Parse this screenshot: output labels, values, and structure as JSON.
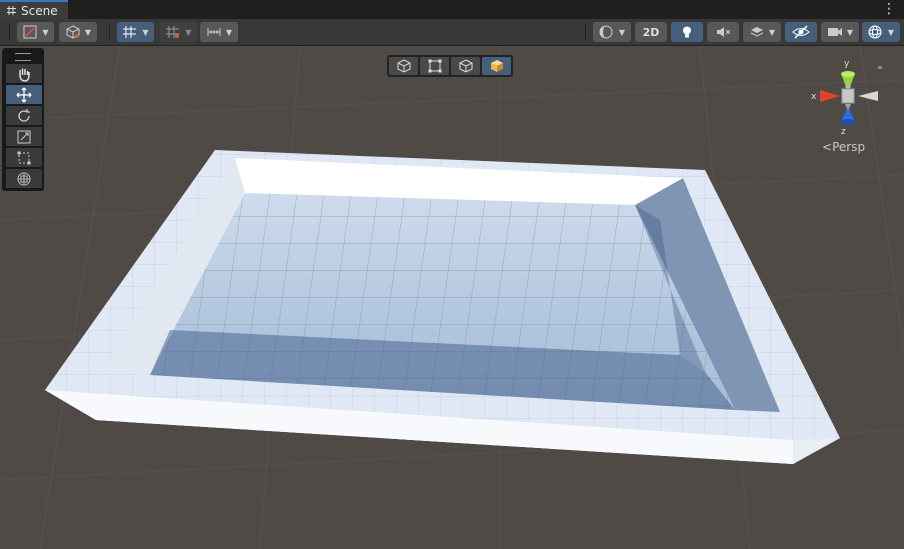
{
  "window": {
    "tab_title": "Scene",
    "menu_icon": "kebab-menu-icon"
  },
  "toolbar": {
    "left_buttons": [
      {
        "name": "draw-mode-button",
        "icon": "draw-mode-icon",
        "has_dropdown": true
      },
      {
        "name": "render-mode-button",
        "icon": "cube-icon",
        "has_dropdown": true
      },
      {
        "name": "grid-snap-button",
        "icon": "grid-snap-icon",
        "has_dropdown": true,
        "active": true
      },
      {
        "name": "grid-settings-button",
        "icon": "grid-icon",
        "has_dropdown": true
      },
      {
        "name": "increment-snap-button",
        "icon": "ruler-icon",
        "has_dropdown": true
      }
    ],
    "right_buttons": [
      {
        "name": "shading-mode-button",
        "icon": "sphere-icon",
        "has_dropdown": true
      },
      {
        "name": "2d-toggle",
        "label": "2D"
      },
      {
        "name": "lighting-toggle",
        "icon": "bulb-icon",
        "active": true
      },
      {
        "name": "audio-toggle",
        "icon": "mute-icon"
      },
      {
        "name": "effects-button",
        "icon": "layers-icon",
        "has_dropdown": true
      },
      {
        "name": "visibility-toggle",
        "icon": "eye-hidden-icon",
        "active": true
      },
      {
        "name": "camera-button",
        "icon": "camera-icon",
        "has_dropdown": true
      },
      {
        "name": "gizmos-button",
        "icon": "gizmo-icon",
        "has_dropdown": true,
        "active": true
      }
    ],
    "two_d_label": "2D"
  },
  "tools": [
    {
      "name": "hand-tool",
      "icon": "hand-icon",
      "active": false
    },
    {
      "name": "move-tool",
      "icon": "move-icon",
      "active": true
    },
    {
      "name": "rotate-tool",
      "icon": "rotate-icon",
      "active": false
    },
    {
      "name": "scale-tool",
      "icon": "scale-icon",
      "active": false
    },
    {
      "name": "rect-tool",
      "icon": "rect-icon",
      "active": false
    },
    {
      "name": "transform-tool",
      "icon": "transform-icon",
      "active": false
    }
  ],
  "overlay_buttons": [
    {
      "name": "wireframe-cube-button",
      "icon": "cube-outline-icon",
      "active": false
    },
    {
      "name": "bounds-button",
      "icon": "bounds-icon",
      "active": false
    },
    {
      "name": "cube-button",
      "icon": "cube-icon",
      "active": false
    },
    {
      "name": "shaded-cube-button",
      "icon": "shaded-cube-icon",
      "active": true
    }
  ],
  "gizmo": {
    "x_label": "x",
    "y_label": "y",
    "z_label": "z",
    "projection_label": "Persp"
  },
  "colors": {
    "accent": "#46607c",
    "background": "#4f4a46",
    "toolbar": "#383838",
    "x_axis": "#e8412a",
    "y_axis": "#8fd43c",
    "z_axis": "#2f6de0"
  }
}
